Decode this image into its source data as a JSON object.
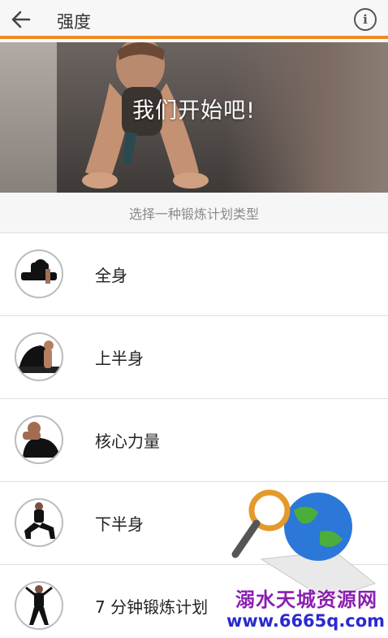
{
  "appbar": {
    "title": "强度",
    "info_glyph": "i",
    "accent_color": "#f08a24"
  },
  "hero": {
    "title": "我们开始吧!"
  },
  "subheader": {
    "text": "选择一种锻炼计划类型"
  },
  "workouts": [
    {
      "label": "全身",
      "icon": "full-body-icon"
    },
    {
      "label": "上半身",
      "icon": "upper-body-icon"
    },
    {
      "label": "核心力量",
      "icon": "core-icon"
    },
    {
      "label": "下半身",
      "icon": "lower-body-icon"
    },
    {
      "label": "7 分钟锻炼计划",
      "icon": "seven-minute-icon"
    }
  ],
  "watermark": {
    "line1": "溺水天城资源网",
    "line2": "www.6665q.com"
  }
}
